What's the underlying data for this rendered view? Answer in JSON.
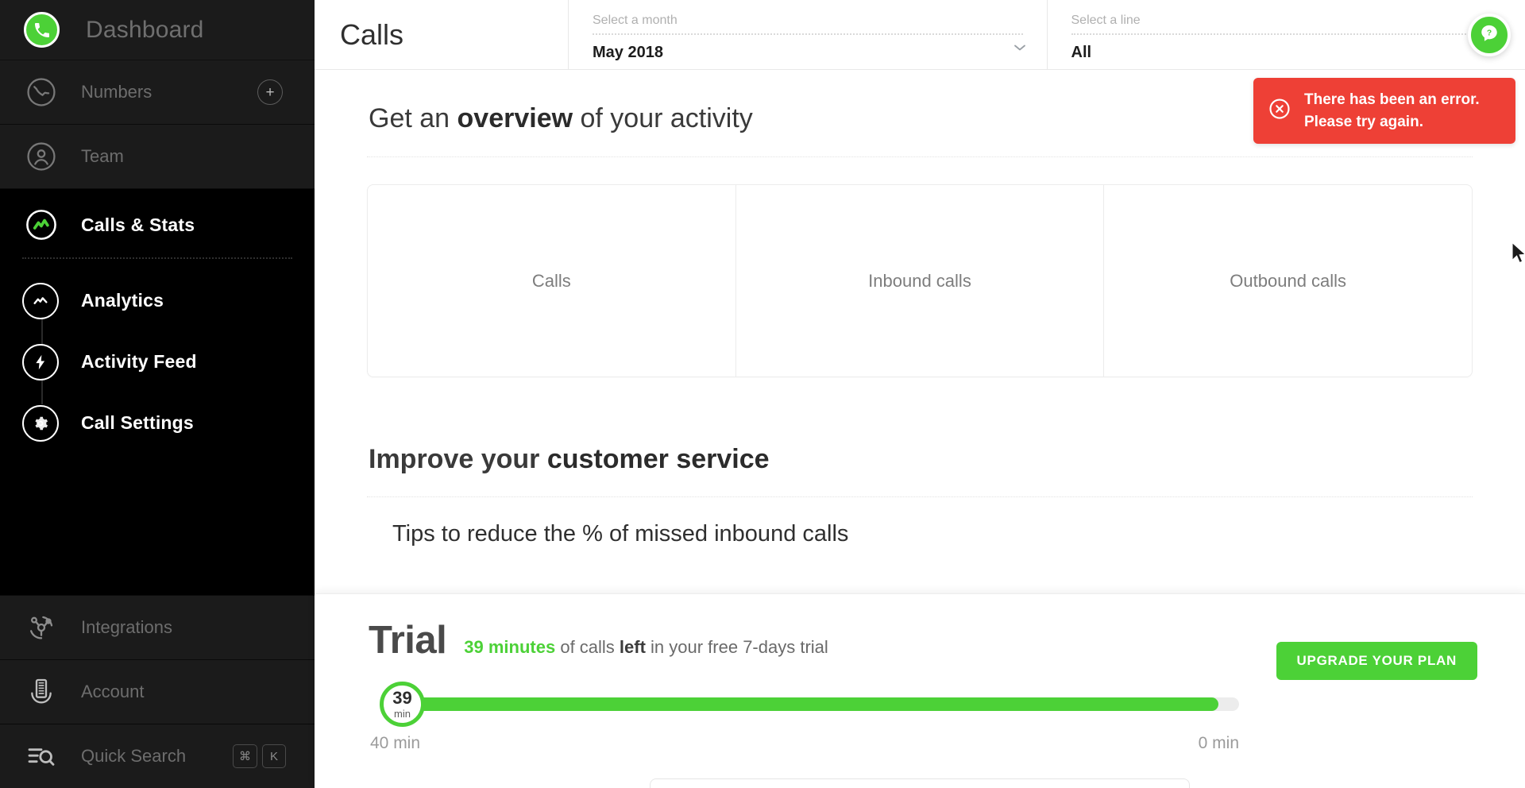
{
  "sidebar": {
    "brand": {
      "title": "Dashboard",
      "icon": "phone-icon",
      "accent": "#4CD137"
    },
    "items": [
      {
        "label": "Numbers",
        "icon": "phone-circle-icon",
        "has_add": true,
        "add_label": "+"
      },
      {
        "label": "Team",
        "icon": "user-circle-icon",
        "has_add": false
      }
    ],
    "active": {
      "label": "Calls & Stats",
      "icon": "stats-circle-icon"
    },
    "subitems": [
      {
        "label": "Analytics",
        "icon": "analytics-icon"
      },
      {
        "label": "Activity Feed",
        "icon": "bolt-icon"
      },
      {
        "label": "Call Settings",
        "icon": "gear-icon"
      }
    ],
    "bottom": [
      {
        "label": "Integrations",
        "icon": "integrations-icon"
      },
      {
        "label": "Account",
        "icon": "building-icon"
      },
      {
        "label": "Quick Search",
        "icon": "search-list-icon",
        "shortcut": [
          "⌘",
          "K"
        ]
      }
    ]
  },
  "topbar": {
    "page_title": "Calls",
    "month_selector": {
      "label": "Select a month",
      "value": "May 2018",
      "caret": "⌄"
    },
    "line_selector": {
      "label": "Select a line",
      "value": "All"
    },
    "help_button": {
      "icon": "question-bubble-icon",
      "label": "?"
    }
  },
  "toast": {
    "icon": "error-circle-icon",
    "line1": "There has been an error.",
    "line2": "Please try again.",
    "color": "#EE4036"
  },
  "overview": {
    "title_pre": "Get an ",
    "title_bold": "overview",
    "title_post": " of your activity",
    "cards": [
      {
        "label": "Calls",
        "value": ""
      },
      {
        "label": "Inbound calls",
        "value": ""
      },
      {
        "label": "Outbound calls",
        "value": ""
      }
    ]
  },
  "improve": {
    "title_pre": "Improve your ",
    "title_bold": "customer service",
    "title_post": "",
    "tip": "Tips to reduce the % of missed inbound calls"
  },
  "trial": {
    "heading": "Trial",
    "minutes_left": "39 minutes",
    "text_mid": " of calls ",
    "text_bold": "left",
    "text_end": " in your free 7-days trial",
    "knob_number": "39",
    "knob_unit": "min",
    "scale_left": "40 min",
    "scale_right": "0 min",
    "progress_percent": 97.5,
    "upgrade_label": "UPGRADE YOUR PLAN",
    "accent": "#4CD137"
  }
}
